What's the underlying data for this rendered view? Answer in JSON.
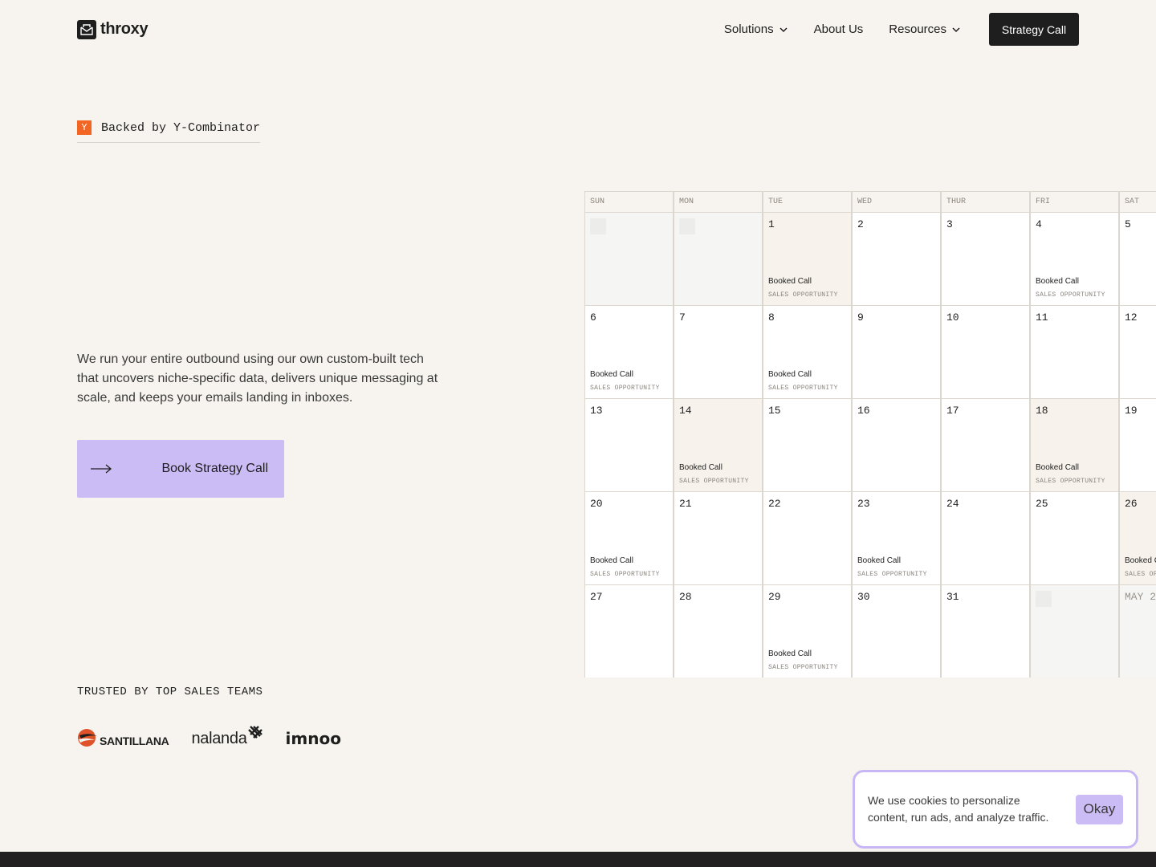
{
  "brand": {
    "name": "throxy"
  },
  "nav": {
    "items": [
      {
        "label": "Solutions",
        "has_dropdown": true
      },
      {
        "label": "About Us",
        "has_dropdown": false
      },
      {
        "label": "Resources",
        "has_dropdown": true
      }
    ],
    "cta_label": "Strategy Call"
  },
  "badge": {
    "icon_letter": "Y",
    "text": "Backed by Y-Combinator"
  },
  "hero": {
    "description": "We run your entire outbound using our own custom-built tech that uncovers niche-specific data, delivers unique messaging at scale, and keeps your emails landing in inboxes.",
    "book_button_label": "Book Strategy Call"
  },
  "trusted": {
    "label": "TRUSTED BY TOP SALES TEAMS",
    "logos": [
      "SANTILLANA",
      "nalanda",
      "imnoo"
    ]
  },
  "calendar": {
    "days": [
      "SUN",
      "MON",
      "TUE",
      "WED",
      "THUR",
      "FRI",
      "SAT"
    ],
    "event_title": "Booked Call",
    "event_subtitle": "SALES OPPORTUNITY",
    "weeks": [
      [
        {
          "day": "",
          "muted": true
        },
        {
          "day": "",
          "muted": true
        },
        {
          "day": "1",
          "booked": true,
          "tint": true
        },
        {
          "day": "2"
        },
        {
          "day": "3"
        },
        {
          "day": "4",
          "booked": true
        },
        {
          "day": "5"
        }
      ],
      [
        {
          "day": "6",
          "booked": true
        },
        {
          "day": "7"
        },
        {
          "day": "8",
          "booked": true
        },
        {
          "day": "9"
        },
        {
          "day": "10"
        },
        {
          "day": "11"
        },
        {
          "day": "12"
        }
      ],
      [
        {
          "day": "13"
        },
        {
          "day": "14",
          "booked": true,
          "tint": true
        },
        {
          "day": "15"
        },
        {
          "day": "16"
        },
        {
          "day": "17"
        },
        {
          "day": "18",
          "booked": true,
          "tint": true
        },
        {
          "day": "19"
        }
      ],
      [
        {
          "day": "20",
          "booked": true
        },
        {
          "day": "21"
        },
        {
          "day": "22"
        },
        {
          "day": "23",
          "booked": true
        },
        {
          "day": "24"
        },
        {
          "day": "25"
        },
        {
          "day": "26",
          "booked": true,
          "tint": true
        }
      ],
      [
        {
          "day": "27"
        },
        {
          "day": "28"
        },
        {
          "day": "29",
          "booked": true
        },
        {
          "day": "30"
        },
        {
          "day": "31"
        },
        {
          "day": "",
          "muted": true
        },
        {
          "day": "MAY 2",
          "muted": true,
          "gray": true
        }
      ]
    ]
  },
  "cookie": {
    "text": "We use cookies to personalize content, run ads, and analyze traffic.",
    "button_label": "Okay"
  },
  "colors": {
    "background": "#f7f4ef",
    "dark": "#1e1e1e",
    "accent_lavender": "#cbbcf6",
    "yc_orange": "#f26522"
  }
}
